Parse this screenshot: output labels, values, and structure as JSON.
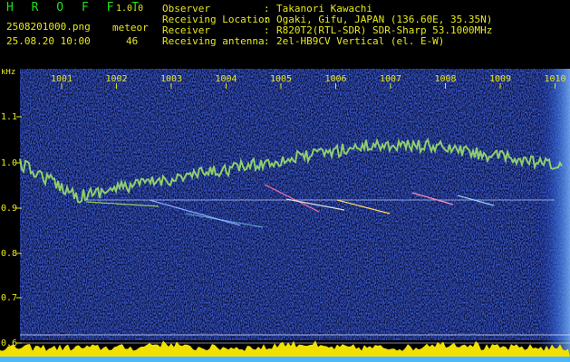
{
  "app": {
    "logo": "H R O F F T",
    "version": "1.0.0"
  },
  "file": {
    "name": "2508201000.png",
    "datetime": "25.08.20 10:00"
  },
  "meteor": {
    "label": "meteor",
    "count": "46"
  },
  "info": [
    {
      "label": "Observer",
      "value": "Takanori Kawachi"
    },
    {
      "label": "Receiving Location",
      "value": "Ogaki, Gifu, JAPAN (136.60E, 35.35N)"
    },
    {
      "label": "Receiver",
      "value": "R820T2(RTL-SDR) SDR-Sharp 53.1000MHz"
    },
    {
      "label": "Receiving antenna",
      "value": "2el-HB9CV Vertical (el. E-W)"
    }
  ],
  "axis": {
    "unit": "kHz",
    "x_ticks": [
      "1001",
      "1002",
      "1003",
      "1004",
      "1005",
      "1006",
      "1007",
      "1008",
      "1009",
      "1010"
    ],
    "y_ticks": [
      "1.1",
      "1.0",
      "0.9",
      "0.8",
      "0.7",
      "0.6"
    ]
  },
  "colors": {
    "background": "#000000",
    "noise_blue": "#1f3bb5",
    "trace": "#8fd06a",
    "label_yellow": "#e8e81e",
    "logo_green": "#1de01d",
    "baseline_yellow": "#f2e100"
  }
}
